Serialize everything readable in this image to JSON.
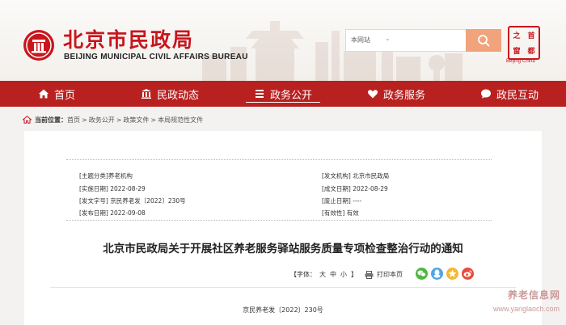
{
  "header": {
    "title_cn": "北京市民政局",
    "title_en": "BEIJING MUNICIPAL CIVIL AFFAIRS BUREAU",
    "search": {
      "scope": "本网站",
      "placeholder": ""
    },
    "seal": {
      "chars": [
        "首",
        "都",
        "之",
        "窗"
      ],
      "caption": "Beijing·China"
    }
  },
  "nav": {
    "items": [
      {
        "label": "首页",
        "icon": "home-icon"
      },
      {
        "label": "民政动态",
        "icon": "building-icon"
      },
      {
        "label": "政务公开",
        "icon": "document-icon",
        "active": true
      },
      {
        "label": "政务服务",
        "icon": "heart-icon"
      },
      {
        "label": "政民互动",
        "icon": "chat-icon"
      }
    ]
  },
  "breadcrumb": {
    "label": "当前位置：",
    "items": [
      "首页",
      "政务公开",
      "政策文件",
      "本局规范性文件"
    ]
  },
  "meta": {
    "topic": "[主题分类]养老机构",
    "issuer": "[发文机构] 北京市民政局",
    "effective_date": "[实施日期] 2022-08-29",
    "written_date": "[成文日期] 2022-08-29",
    "doc_no": "[发文字号] 京民养老发〔2022〕230号",
    "repeal_date": "[废止日期] ----",
    "publish_date": "[发布日期] 2022-09-08",
    "validity": "[有效性] 有效"
  },
  "document": {
    "title": "北京市民政局关于开展社区养老服务驿站服务质量专项检查整治行动的通知",
    "number": "京民养老发〔2022〕230号"
  },
  "toolbar": {
    "font_label": "【字体：",
    "sizes": [
      "大",
      "中",
      "小"
    ],
    "font_close": "】",
    "print_label": "打印本页"
  },
  "share": [
    "wechat-icon",
    "qq-icon",
    "qzone-icon",
    "weibo-icon"
  ],
  "watermark": {
    "cn": "养老信息网",
    "en": "www.yanglaoch.com"
  },
  "colors": {
    "brand_red": "#b92120",
    "title_red": "#c8161d",
    "search_btn": "#f1a37c"
  }
}
